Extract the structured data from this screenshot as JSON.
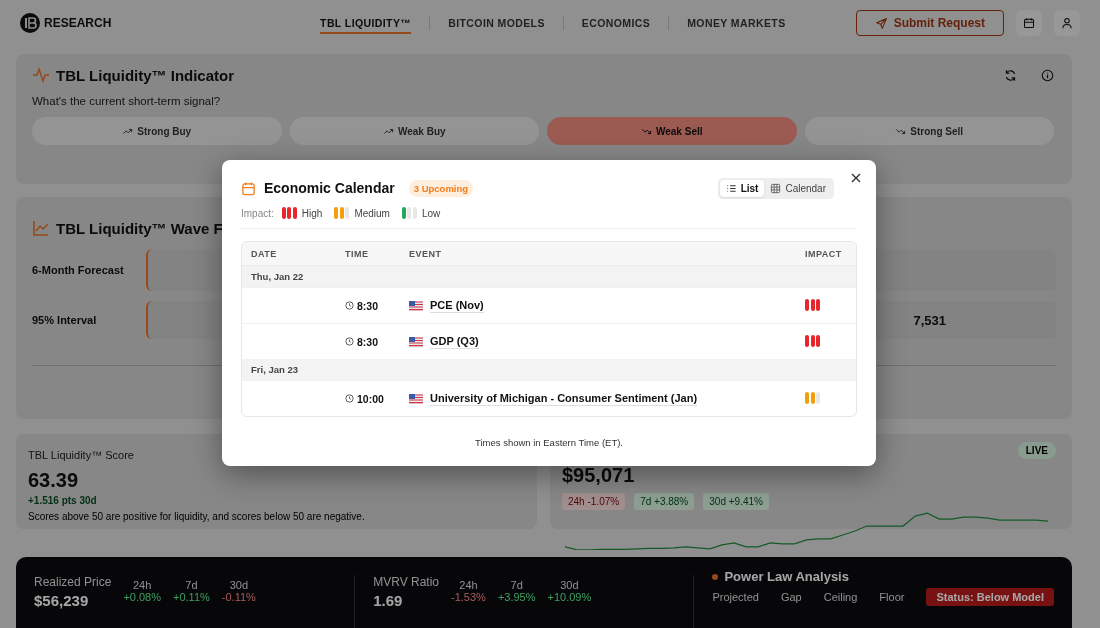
{
  "nav": {
    "brand": "RESEARCH",
    "tabs": [
      {
        "label": "TBL LIQUIDITY™",
        "selected": true
      },
      {
        "label": "BITCOIN MODELS",
        "selected": false
      },
      {
        "label": "ECONOMICS",
        "selected": false
      },
      {
        "label": "MONEY MARKETS",
        "selected": false
      }
    ],
    "submit_button": "Submit Request"
  },
  "indicator": {
    "title": "TBL Liquidity™ Indicator",
    "question": "What's the current short-term signal?",
    "signals": [
      {
        "label": "Strong Buy",
        "kind": "up",
        "selected": false
      },
      {
        "label": "Weak Buy",
        "kind": "up",
        "selected": false
      },
      {
        "label": "Weak Sell",
        "kind": "down",
        "selected": true
      },
      {
        "label": "Strong Sell",
        "kind": "down",
        "selected": false
      }
    ]
  },
  "wave": {
    "title": "TBL Liquidity™ Wave F",
    "rows": [
      {
        "label": "6-Month Forecast"
      },
      {
        "label": "95% Interval",
        "value": "7,531"
      }
    ]
  },
  "score": {
    "title": "TBL Liquidity™ Score",
    "value": "63.39",
    "change": "+1.516 pts 30d",
    "note": "Scores above 50 are positive for liquidity, and scores below 50 are negative."
  },
  "price": {
    "badge": "LIVE",
    "value": "$95,071",
    "changes": [
      {
        "label": "24h -1.07%",
        "kind": "down"
      },
      {
        "label": "7d +3.88%",
        "kind": "up"
      },
      {
        "label": "30d +9.41%",
        "kind": "up"
      }
    ]
  },
  "metrics": [
    {
      "label": "Realized Price",
      "value": "$56,239",
      "periods": [
        {
          "label": "24h",
          "change": "+0.08%",
          "kind": "up"
        },
        {
          "label": "7d",
          "change": "+0.11%",
          "kind": "up"
        },
        {
          "label": "30d",
          "change": "-0.11%",
          "kind": "down"
        }
      ]
    },
    {
      "label": "MVRV Ratio",
      "value": "1.69",
      "periods": [
        {
          "label": "24h",
          "change": "-1.53%",
          "kind": "down"
        },
        {
          "label": "7d",
          "change": "+3.95%",
          "kind": "up"
        },
        {
          "label": "30d",
          "change": "+10.09%",
          "kind": "up"
        }
      ]
    }
  ],
  "power_law": {
    "title": "Power Law Analysis",
    "columns": [
      "Projected",
      "Gap",
      "Ceiling",
      "Floor"
    ],
    "status": "Status: Below Model"
  },
  "modal": {
    "title": "Economic Calendar",
    "badge": "3 Upcoming",
    "views": [
      {
        "label": "List",
        "kind": "list",
        "selected": true
      },
      {
        "label": "Calendar",
        "kind": "grid",
        "selected": false
      }
    ],
    "legend_label": "Impact:",
    "legend": [
      {
        "label": "High",
        "kind": "high"
      },
      {
        "label": "Medium",
        "kind": "medium"
      },
      {
        "label": "Low",
        "kind": "low"
      }
    ],
    "columns": [
      "DATE",
      "TIME",
      "EVENT",
      "IMPACT"
    ],
    "days": [
      {
        "date": "Thu, Jan 22",
        "events": [
          {
            "time": "8:30",
            "event": "PCE (Nov)",
            "kind": "high"
          },
          {
            "time": "8:30",
            "event": "GDP (Q3)",
            "kind": "high"
          }
        ]
      },
      {
        "date": "Fri, Jan 23",
        "events": [
          {
            "time": "10:00",
            "event": "University of Michigan - Consumer Sentiment (Jan)",
            "kind": "medium"
          }
        ]
      }
    ],
    "footer": "Times shown in Eastern Time (ET)."
  }
}
